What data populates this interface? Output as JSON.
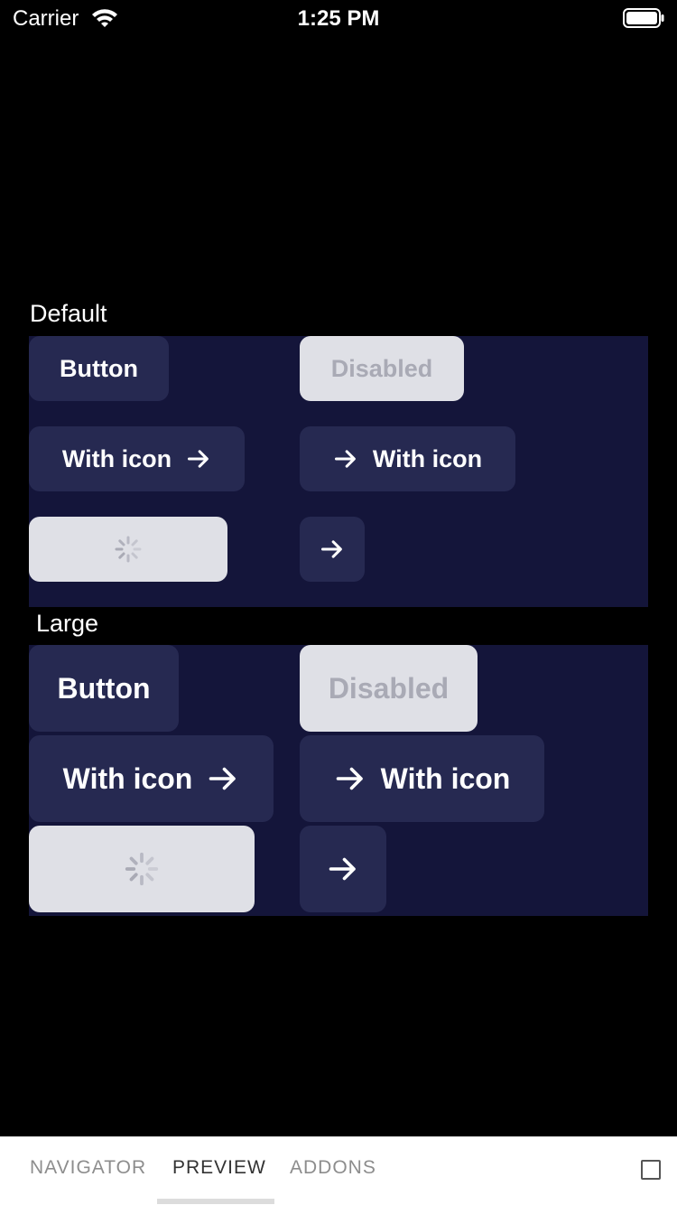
{
  "status_bar": {
    "carrier": "Carrier",
    "time": "1:25 PM"
  },
  "sections": {
    "default": {
      "label": "Default",
      "button": "Button",
      "disabled": "Disabled",
      "with_icon_trailing": "With icon",
      "with_icon_leading": "With icon"
    },
    "large": {
      "label": "Large",
      "button": "Button",
      "disabled": "Disabled",
      "with_icon_trailing": "With icon",
      "with_icon_leading": "With icon"
    }
  },
  "icons": {
    "arrow": "arrow-right-icon",
    "spinner": "loading-spinner-icon",
    "wifi": "wifi-icon",
    "battery": "battery-icon"
  },
  "colors": {
    "panel_background": "#14153a",
    "button_background": "#262951",
    "disabled_background": "#dfe0e6",
    "disabled_text": "#a9aab5"
  },
  "bottom_bar": {
    "tabs": [
      "NAVIGATOR",
      "PREVIEW",
      "ADDONS"
    ],
    "active_tab": "PREVIEW"
  }
}
